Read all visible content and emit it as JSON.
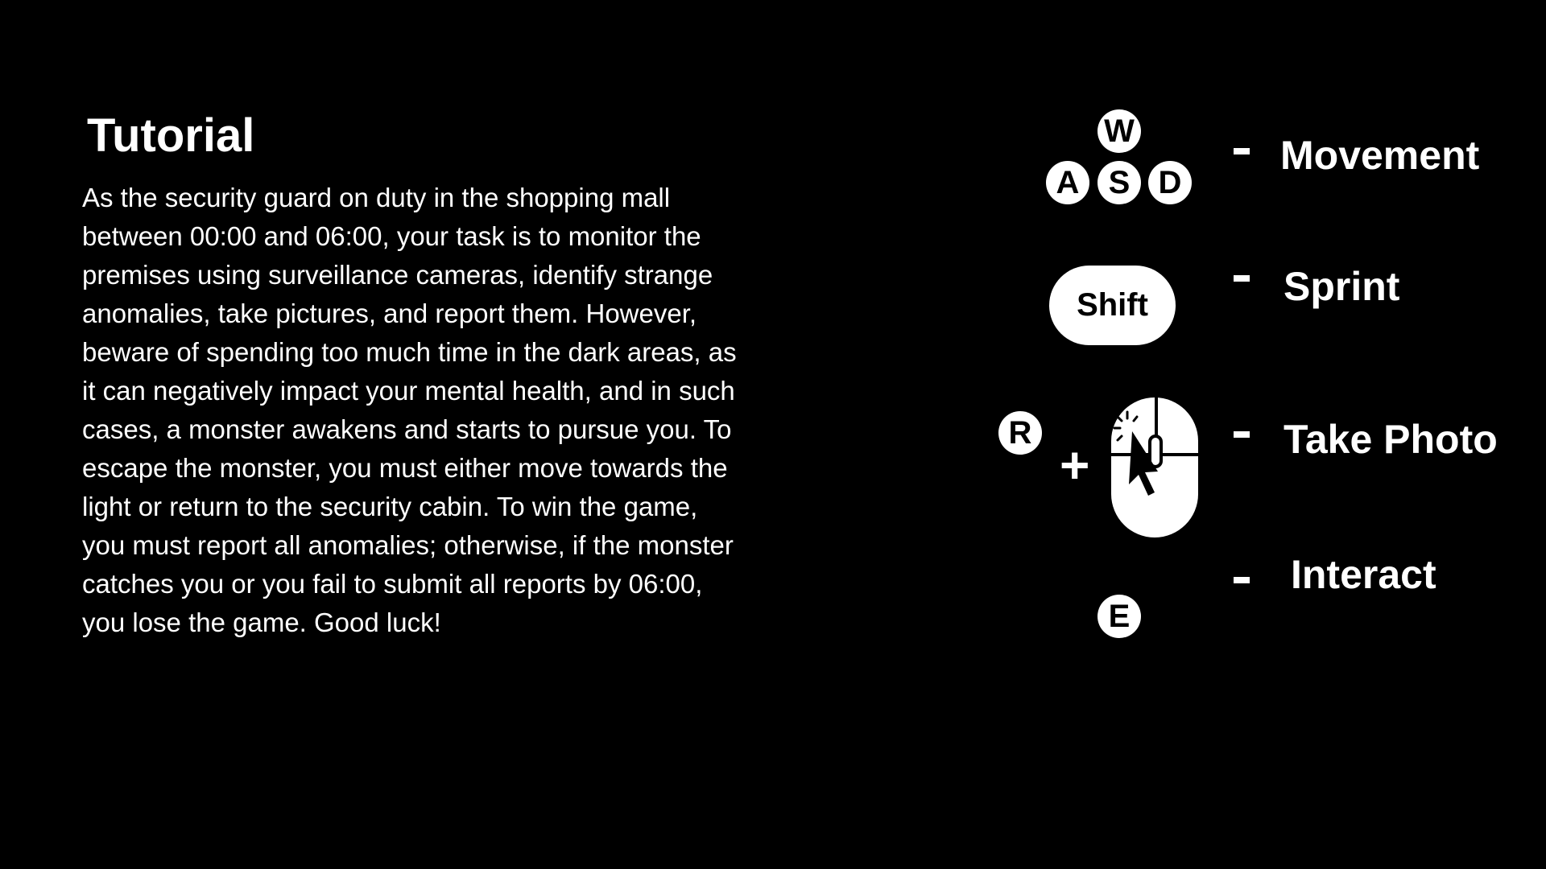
{
  "tutorial": {
    "title": "Tutorial",
    "lines": [
      "As the security guard on duty in the shopping mall",
      "between 00:00 and 06:00, your task is to monitor the",
      "premises using surveillance cameras, identify strange",
      "anomalies, take pictures, and report them. However,",
      "beware of spending too much time in the dark areas, as",
      "it can negatively impact your mental health, and in such",
      "cases, a monster awakens and starts to pursue you. To",
      "escape the monster, you must either move towards the",
      "light or return to the security cabin. To win the game,",
      "you must report all anomalies; otherwise, if the monster",
      "catches you or you fail to submit all reports by 06:00,",
      "you lose the game. Good luck!"
    ]
  },
  "controls": {
    "movement": {
      "keys": [
        "W",
        "A",
        "S",
        "D"
      ],
      "separator": "-",
      "label": "Movement"
    },
    "sprint": {
      "key": "Shift",
      "separator": "-",
      "label": "Sprint"
    },
    "photo": {
      "key": "R",
      "plus": "+",
      "mouse_icon": "mouse-left-click-icon",
      "separator": "-",
      "label": "Take Photo"
    },
    "interact": {
      "key": "E",
      "separator": "-",
      "label": "Interact"
    }
  },
  "colors": {
    "background": "#000000",
    "foreground": "#ffffff"
  }
}
